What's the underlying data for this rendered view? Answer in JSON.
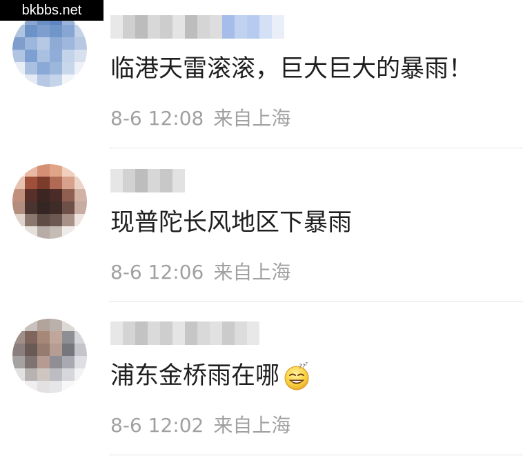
{
  "watermark": "bkbbs.net",
  "comments": [
    {
      "text": "临港天雷滚滚，巨大巨大的暴雨！",
      "time": "8-6 12:08",
      "source": "来自上海",
      "avatar_colors": [
        "#dfe7ef",
        "#8ca7cf",
        "#6a8fc3",
        "#5f86c2",
        "#9bb3d7",
        "#e6edf5",
        "#b0c4e0",
        "#6c93c8",
        "#7d9ecf",
        "#6f95c9",
        "#87a6d3",
        "#c3d2e7",
        "#7f9dcd",
        "#9db6dc",
        "#b6c9e4",
        "#8eabd6",
        "#9fb7dc",
        "#b7c8e3",
        "#b1c5e2",
        "#7d9fd2",
        "#aac0e1",
        "#8fadd8",
        "#c4d3ea",
        "#d6e0ee",
        "#e8eef6",
        "#a9c0e0",
        "#8aa9d6",
        "#9db6db",
        "#c9d7eb",
        "#eef2f8",
        "#ffffff",
        "#e3eaf4",
        "#b6c8e4",
        "#c5d4ea",
        "#f1f4f9",
        "#ffffff"
      ],
      "name_colors": [
        "#e8e8e8",
        "#cfcfcf",
        "#bcbcbc",
        "#d8d8d8",
        "#cdcdcd",
        "#e4e4e4",
        "#bdbdbd",
        "#d5d5d5",
        "#dddddd",
        "#a5bde8",
        "#c0d2f0",
        "#b6cbef",
        "#d3e0f5",
        "#e9eef8"
      ]
    },
    {
      "text": "现普陀长风地区下暴雨",
      "time": "8-6 12:06",
      "source": "来自上海",
      "avatar_colors": [
        "#f7e9e1",
        "#e9b9a3",
        "#d48f74",
        "#e0a487",
        "#f1cfbe",
        "#fbf3ee",
        "#e6c2b1",
        "#a0503a",
        "#7d3b2c",
        "#b06a55",
        "#d7a18c",
        "#ecd4c9",
        "#c0907c",
        "#593029",
        "#3d2522",
        "#4b2c28",
        "#8f5f51",
        "#d2b2a4",
        "#b38e7f",
        "#4a3430",
        "#352624",
        "#3f2c29",
        "#6f5048",
        "#c7aca1",
        "#e0d3cc",
        "#8a776e",
        "#5f4c44",
        "#6b5850",
        "#a89287",
        "#ede4df",
        "#ffffff",
        "#e6e0dc",
        "#b8aca6",
        "#c6bcb6",
        "#f0ebe8",
        "#ffffff"
      ],
      "name_colors": [
        "#e6e6e6",
        "#d2d2d2",
        "#bdbdbd",
        "#d7d7d7",
        "#c8c8c8",
        "#e2e2e2"
      ]
    },
    {
      "text": "浦东金桥雨在哪",
      "time": "8-6 12:02",
      "source": "来自上海",
      "emoji_name": "dizzy-sweat-emoji",
      "avatar_colors": [
        "#eeeeee",
        "#c8c1bd",
        "#b2a49c",
        "#bbb0aa",
        "#dcd8d6",
        "#f7f7f7",
        "#9e8f88",
        "#7f655b",
        "#a68778",
        "#c1a79b",
        "#8e8f94",
        "#d5d6da",
        "#8a7f7c",
        "#6a5a55",
        "#967b70",
        "#b59d93",
        "#75777c",
        "#c4c5ca",
        "#a7a2a2",
        "#807472",
        "#b59b91",
        "#8f8e94",
        "#a9aab1",
        "#dedfe3",
        "#e2e1e1",
        "#b7b3b3",
        "#d0c6c1",
        "#bcbcc2",
        "#d6d7db",
        "#f3f3f4",
        "#ffffff",
        "#f0efef",
        "#e3e1e1",
        "#e6e6e8",
        "#f7f7f8",
        "#ffffff"
      ],
      "name_colors": [
        "#e7e7e7",
        "#d4d4d4",
        "#c3c3c3",
        "#dadada",
        "#cecece",
        "#e5e5e5",
        "#c6c6c6",
        "#d9d9d9",
        "#e1e1e1",
        "#cbcbcb",
        "#dcdcdc",
        "#e8e8e8"
      ]
    }
  ]
}
